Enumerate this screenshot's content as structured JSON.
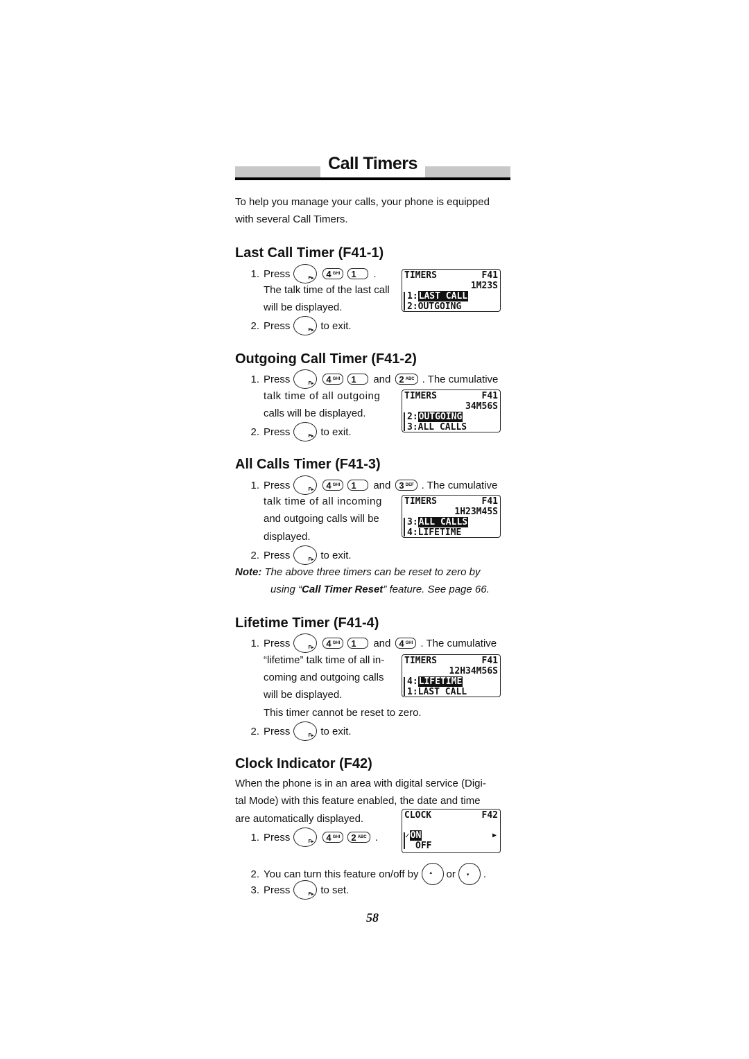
{
  "title": "Call Timers",
  "intro": [
    "To help you manage your calls, your phone is equipped",
    "with several Call Timers."
  ],
  "keys": {
    "f": "F▸",
    "four": {
      "digit": "4",
      "letters": "GHI"
    },
    "one": {
      "digit": "1",
      "letters": ""
    },
    "two": {
      "digit": "2",
      "letters": "ABC"
    },
    "three": {
      "digit": "3",
      "letters": "DEF"
    },
    "up": "▴",
    "down": "▾"
  },
  "words": {
    "press": "Press",
    "and": "and",
    "or": "or",
    "to_exit": "to exit.",
    "to_set": "to set.",
    "period": ".",
    "cumulative": ". The cumulative"
  },
  "sections": [
    {
      "heading": "Last Call Timer (F41-1)",
      "step1_text": [
        "The talk time of the last call",
        "will be displayed."
      ],
      "lcd": {
        "title": "TIMERS",
        "code": "F41",
        "value": "1M23S",
        "sel_num": "1:",
        "sel": "LAST CALL",
        "next": "2:OUTGOING"
      }
    },
    {
      "heading": "Outgoing Call Timer (F41-2)",
      "step1_text": [
        "talk time of all outgoing",
        "calls will be displayed."
      ],
      "lcd": {
        "title": "TIMERS",
        "code": "F41",
        "value": "34M56S",
        "sel_num": "2:",
        "sel": "OUTGOING",
        "next": "3:ALL CALLS"
      }
    },
    {
      "heading": "All Calls Timer (F41-3)",
      "step1_text": [
        "talk time of all incoming",
        "and outgoing calls will be",
        "displayed."
      ],
      "lcd": {
        "title": "TIMERS",
        "code": "F41",
        "value": "1H23M45S",
        "sel_num": "3:",
        "sel": "ALL CALLS",
        "next": "4:LIFETIME"
      }
    },
    {
      "heading": "Lifetime Timer (F41-4)",
      "step1_text": [
        "“lifetime” talk time of all in-",
        "coming and outgoing calls",
        "will be displayed.",
        "This timer cannot be reset to zero."
      ],
      "lcd": {
        "title": "TIMERS",
        "code": "F41",
        "value": "12H34M56S",
        "sel_num": "4:",
        "sel": "LIFETIME",
        "next": "1:LAST CALL"
      }
    }
  ],
  "note": {
    "label": "Note:",
    "text1": "The above three timers can be reset to zero by",
    "text2a": "using “",
    "text2b": "Call Timer Reset",
    "text2c": "” feature. See page 66."
  },
  "clock": {
    "heading": "Clock Indicator (F42)",
    "text": [
      "When the phone is in an area with digital service (Digi-",
      "tal Mode) with this feature enabled, the date and time",
      "are automatically displayed."
    ],
    "step2": "You can turn this feature on/off by",
    "lcd": {
      "title": "CLOCK",
      "code": "F42",
      "check": "✓",
      "on": "ON",
      "off": "OFF",
      "arrow": "▶"
    }
  },
  "page_number": "58"
}
